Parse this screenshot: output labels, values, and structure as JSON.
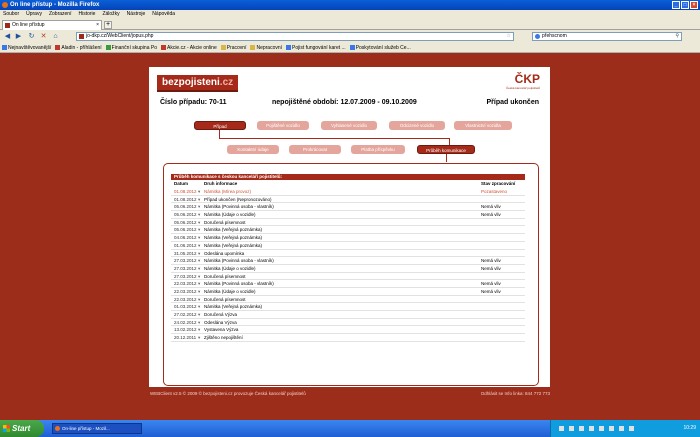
{
  "window": {
    "title": "On line přístup - Mozilla Firefox"
  },
  "menu": [
    "Soubor",
    "Úpravy",
    "Zobrazení",
    "Historie",
    "Záložky",
    "Nástroje",
    "Nápověda"
  ],
  "tab": {
    "label": "On line přístup"
  },
  "url": "jo-dkp.cz/WebClient/jopus.php",
  "search": {
    "value": "přehscnom"
  },
  "bookmarks": [
    "Nejnavštěvovanější",
    "Aladin - příhlášení",
    "Finanční skupina Po",
    "Akcie.cz - Akcie online",
    "Pracovní",
    "Nepracovní",
    "Pojist fungování karet ...",
    "Poskytování služeb Ce..."
  ],
  "site": {
    "logo_main": "bezpojisteni",
    "logo_tld": ".cz",
    "ckp_logo": "ČKP",
    "ckp_sub": "Česká kancelář pojistitelů",
    "case_label": "Číslo případu: 70-11",
    "period_label": "nepojištěné období: 12.07.2009 - 09.10.2009",
    "status_label": "Případ ukončen"
  },
  "nav_row1": [
    "Případ",
    "Pojištěné vozidlo",
    "Vyhlasené vozidlo",
    "Odcizené vozidlo",
    "Vlastnictví vozidla"
  ],
  "nav_row2": [
    "Kontaktní údaje",
    "Prokrácovat",
    "Platba příspěvku",
    "Průběh komunikace"
  ],
  "panel": {
    "title": "Průběh komunikace s českou kanceláří pojistitelů:",
    "col_date": "Datum",
    "col_info": "Druh informace",
    "col_status": "Stav zpracování"
  },
  "rows": [
    {
      "date": "01.08.2012",
      "info": "Námitka (Mírea provoz)",
      "status": "Pozastaveno"
    },
    {
      "date": "01.08.2012",
      "info": "Případ ukončen (Nepronozováno)",
      "status": ""
    },
    {
      "date": "05.06.2012",
      "info": "Námitka (Povinná osoba - vlastník)",
      "status": "Nemá vliv"
    },
    {
      "date": "05.06.2012",
      "info": "Námitka (Údaje o vozidle)",
      "status": "Nemá vliv"
    },
    {
      "date": "05.06.2012",
      "info": "Doručená písemnost",
      "status": ""
    },
    {
      "date": "05.06.2012",
      "info": "Námitka (Veřejná poznámka)",
      "status": ""
    },
    {
      "date": "04.06.2012",
      "info": "Námitka (Veřejná poznámka)",
      "status": ""
    },
    {
      "date": "01.06.2012",
      "info": "Námitka (Veřejná poznámka)",
      "status": ""
    },
    {
      "date": "31.05.2012",
      "info": "Odeslána upomínka",
      "status": ""
    },
    {
      "date": "27.03.2012",
      "info": "Námitka (Povinná osoba - vlastník)",
      "status": "Nemá vliv"
    },
    {
      "date": "27.03.2012",
      "info": "Námitka (Údaje o vozidle)",
      "status": "Nemá vliv"
    },
    {
      "date": "27.03.2012",
      "info": "Doručená písemnost",
      "status": ""
    },
    {
      "date": "22.03.2012",
      "info": "Námitka (Povinná osoba - vlastník)",
      "status": "Nemá vliv"
    },
    {
      "date": "22.03.2012",
      "info": "Námitka (Údaje o vozidle)",
      "status": "Nemá vliv"
    },
    {
      "date": "22.03.2012",
      "info": "Doručená písemnost",
      "status": ""
    },
    {
      "date": "01.03.2012",
      "info": "Námitka (Veřejná poznámka)",
      "status": ""
    },
    {
      "date": "27.02.2012",
      "info": "Doručená Výzva",
      "status": ""
    },
    {
      "date": "24.02.2012",
      "info": "Odeslána Výzva",
      "status": ""
    },
    {
      "date": "13.02.2012",
      "info": "Vystavena Výzva",
      "status": ""
    },
    {
      "date": "20.12.2011",
      "info": "Zjištěno nepojištění",
      "status": ""
    }
  ],
  "footer": {
    "left": "WEBClient v2.5  © 2009 © bezpojisteni.cz provozuje Česká kancelář pojistitelů",
    "right": "Odhlásit se   Info linka: 844 772 773"
  },
  "taskbar": {
    "start": "Start",
    "item": "On-line přístup - Mozil...",
    "clock": "10:29"
  },
  "colors": {
    "brand": "#a52a1a",
    "background": "#9d2d1b",
    "highlight": "#d0502f"
  }
}
